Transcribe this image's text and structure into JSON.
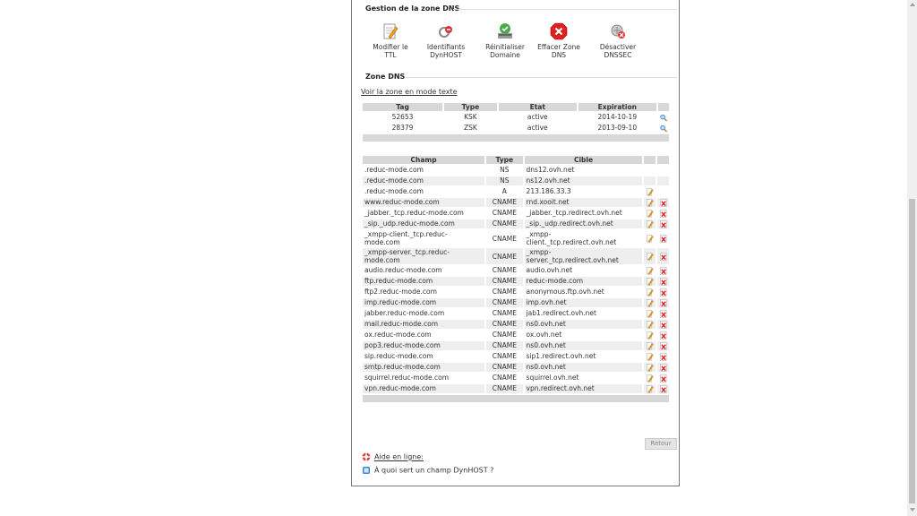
{
  "gestion": {
    "title": "Gestion de la zone DNS",
    "tools": [
      {
        "label": "Modifier le TTL",
        "icon": "pencil-doc-icon"
      },
      {
        "label": "Identifiants DynHOST",
        "icon": "dynhost-icon"
      },
      {
        "label": "Réinitialiser Domaine",
        "icon": "reset-icon"
      },
      {
        "label": "Effacer Zone DNS",
        "icon": "delete-red-icon"
      },
      {
        "label": "Désactiver DNSSEC",
        "icon": "dnssec-disable-icon"
      }
    ]
  },
  "zone": {
    "title": "Zone DNS",
    "text_link": "Voir la zone en mode texte",
    "dnssec_table": {
      "headers": [
        "Tag",
        "Type",
        "Etat",
        "Expiration"
      ],
      "rows": [
        [
          "52653",
          "KSK",
          "active",
          "2014-10-19"
        ],
        [
          "28379",
          "ZSK",
          "active",
          "2013-09-10"
        ]
      ]
    },
    "records_table": {
      "headers": [
        "Champ",
        "Type",
        "Cible"
      ],
      "rows": [
        {
          "champ": ".reduc-mode.com",
          "type": "NS",
          "cible": "dns12.ovh.net",
          "edit": false,
          "del": false
        },
        {
          "champ": ".reduc-mode.com",
          "type": "NS",
          "cible": "ns12.ovh.net",
          "edit": false,
          "del": false
        },
        {
          "champ": ".reduc-mode.com",
          "type": "A",
          "cible": "213.186.33.3",
          "edit": true,
          "del": false
        },
        {
          "champ": "www.reduc-mode.com",
          "type": "CNAME",
          "cible": "rnd.xooit.net",
          "edit": true,
          "del": true
        },
        {
          "champ": "_jabber._tcp.reduc-mode.com",
          "type": "CNAME",
          "cible": "_jabber._tcp.redirect.ovh.net",
          "edit": true,
          "del": true
        },
        {
          "champ": "_sip._udp.reduc-mode.com",
          "type": "CNAME",
          "cible": "_sip._udp.redirect.ovh.net",
          "edit": true,
          "del": true
        },
        {
          "champ": "_xmpp-client._tcp.reduc-mode.com",
          "type": "CNAME",
          "cible": "_xmpp-client._tcp.redirect.ovh.net",
          "edit": true,
          "del": true
        },
        {
          "champ": "_xmpp-server._tcp.reduc-mode.com",
          "type": "CNAME",
          "cible": "_xmpp-server._tcp.redirect.ovh.net",
          "edit": true,
          "del": true
        },
        {
          "champ": "audio.reduc-mode.com",
          "type": "CNAME",
          "cible": "audio.ovh.net",
          "edit": true,
          "del": true
        },
        {
          "champ": "ftp.reduc-mode.com",
          "type": "CNAME",
          "cible": "reduc-mode.com",
          "edit": true,
          "del": true
        },
        {
          "champ": "ftp2.reduc-mode.com",
          "type": "CNAME",
          "cible": "anonymous.ftp.ovh.net",
          "edit": true,
          "del": true
        },
        {
          "champ": "imp.reduc-mode.com",
          "type": "CNAME",
          "cible": "imp.ovh.net",
          "edit": true,
          "del": true
        },
        {
          "champ": "jabber.reduc-mode.com",
          "type": "CNAME",
          "cible": "jab1.redirect.ovh.net",
          "edit": true,
          "del": true
        },
        {
          "champ": "mail.reduc-mode.com",
          "type": "CNAME",
          "cible": "ns0.ovh.net",
          "edit": true,
          "del": true
        },
        {
          "champ": "ox.reduc-mode.com",
          "type": "CNAME",
          "cible": "ox.ovh.net",
          "edit": true,
          "del": true
        },
        {
          "champ": "pop3.reduc-mode.com",
          "type": "CNAME",
          "cible": "ns0.ovh.net",
          "edit": true,
          "del": true
        },
        {
          "champ": "sip.reduc-mode.com",
          "type": "CNAME",
          "cible": "sip1.redirect.ovh.net",
          "edit": true,
          "del": true
        },
        {
          "champ": "smtp.reduc-mode.com",
          "type": "CNAME",
          "cible": "ns0.ovh.net",
          "edit": true,
          "del": true
        },
        {
          "champ": "squirrel.reduc-mode.com",
          "type": "CNAME",
          "cible": "squirrel.ovh.net",
          "edit": true,
          "del": true
        },
        {
          "champ": "vpn.reduc-mode.com",
          "type": "CNAME",
          "cible": "vpn.redirect.ovh.net",
          "edit": true,
          "del": true
        }
      ]
    }
  },
  "actions": {
    "retour": "Retour"
  },
  "help": {
    "online": "Aide en ligne:",
    "dynhost_question": "À quoi sert un champ DynHOST ?"
  }
}
